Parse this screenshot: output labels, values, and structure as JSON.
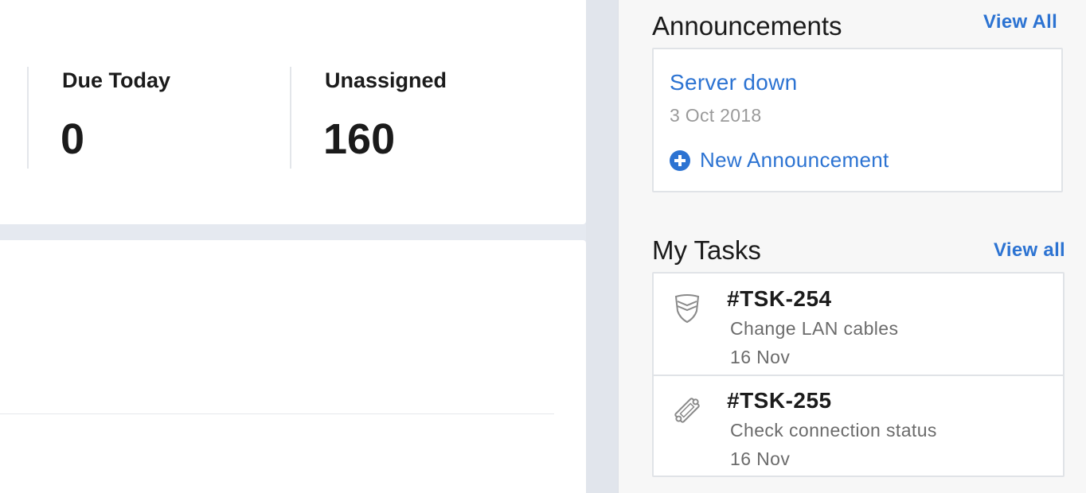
{
  "stats": {
    "due_today": {
      "label": "Due Today",
      "value": "0"
    },
    "unassigned": {
      "label": "Unassigned",
      "value": "160"
    }
  },
  "announcements": {
    "title": "Announcements",
    "view_all": "View All",
    "items": [
      {
        "title": "Server down",
        "date": "3 Oct 2018"
      }
    ],
    "new_label": "New Announcement"
  },
  "my_tasks": {
    "title": "My Tasks",
    "view_all": "View all",
    "items": [
      {
        "id": "#TSK-254",
        "description": "Change LAN cables",
        "date": "16 Nov",
        "icon": "shield-icon"
      },
      {
        "id": "#TSK-255",
        "description": "Check connection status",
        "date": "16 Nov",
        "icon": "ticket-icon"
      }
    ]
  },
  "colors": {
    "accent": "#2c73d2",
    "background": "#e5e9f0",
    "sidebar": "#f7f7f7"
  }
}
